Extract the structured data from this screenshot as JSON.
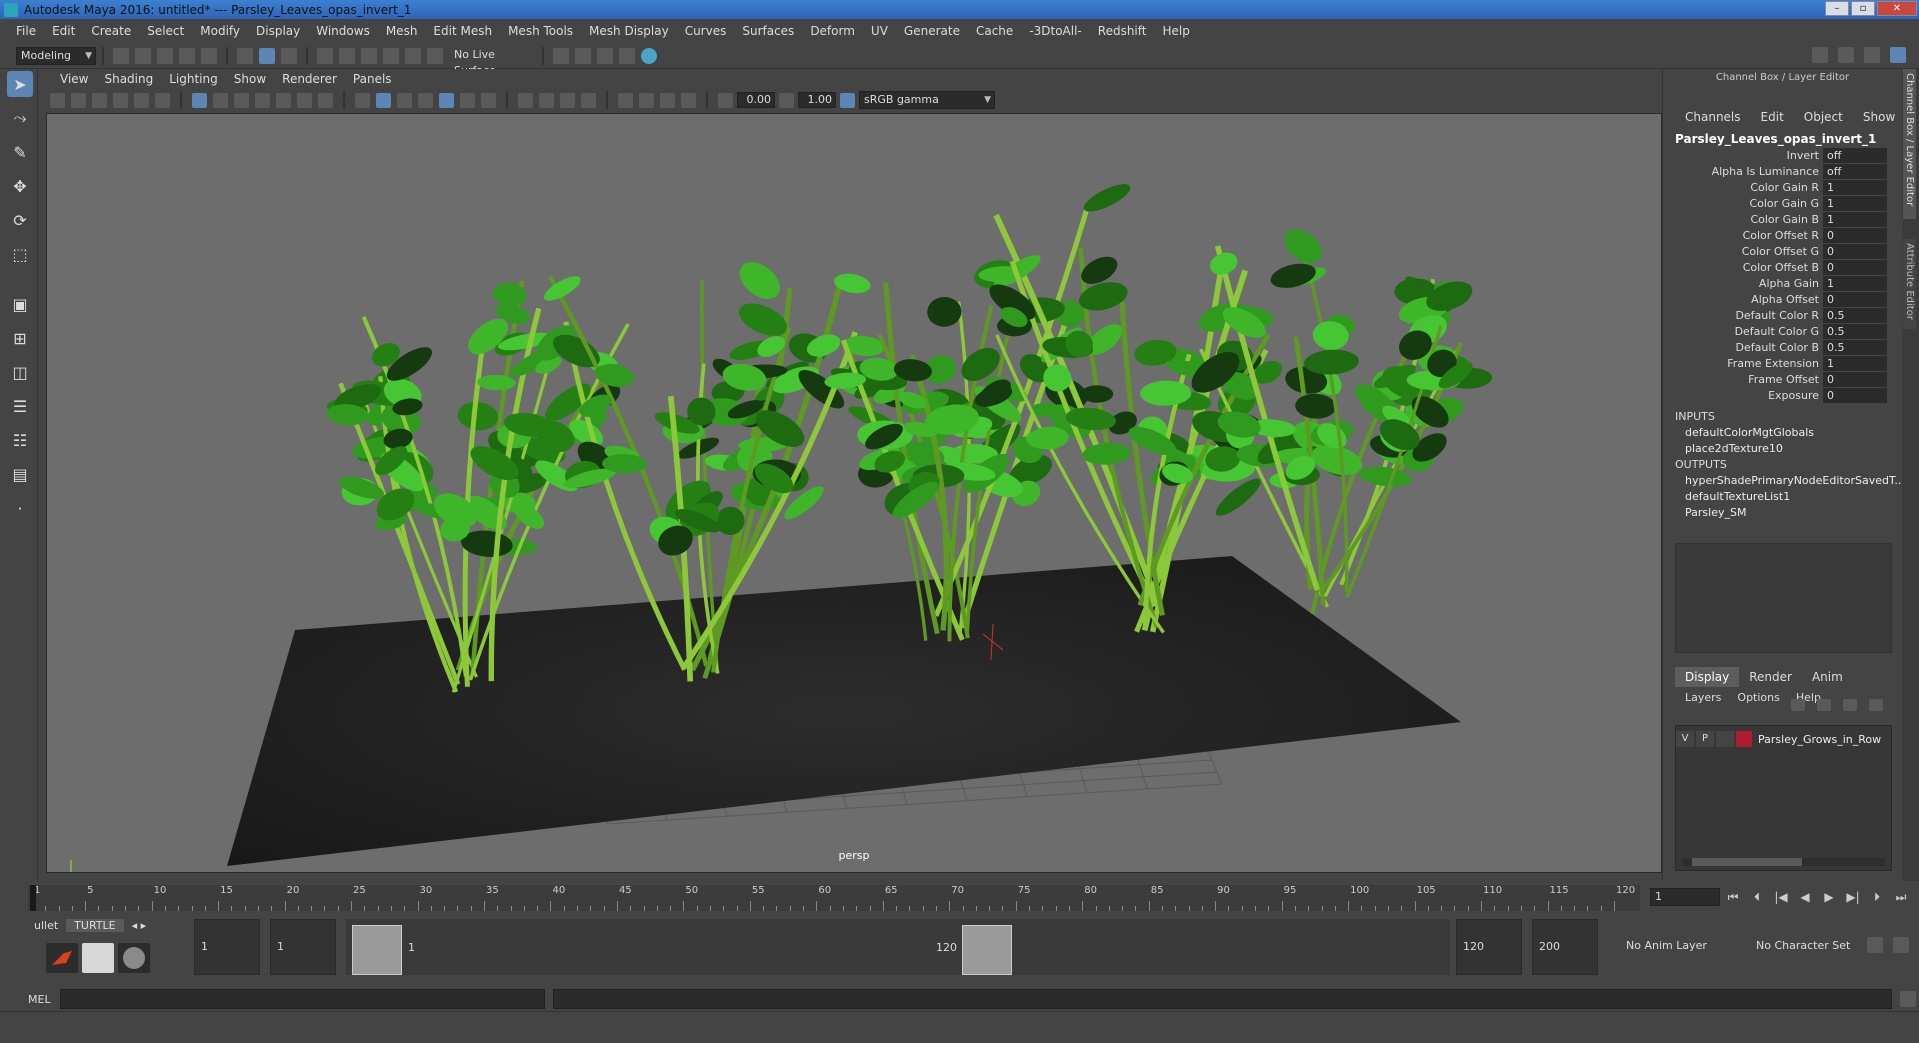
{
  "window": {
    "title": "Autodesk Maya 2016: untitled*   ---   Parsley_Leaves_opas_invert_1"
  },
  "menubar": [
    "File",
    "Edit",
    "Create",
    "Select",
    "Modify",
    "Display",
    "Windows",
    "Mesh",
    "Edit Mesh",
    "Mesh Tools",
    "Mesh Display",
    "Curves",
    "Surfaces",
    "Deform",
    "UV",
    "Generate",
    "Cache",
    "-3DtoAll-",
    "Redshift",
    "Help"
  ],
  "statusline": {
    "menu_set": "Modeling",
    "live_surface": "No Live Surface"
  },
  "panel": {
    "menus": [
      "View",
      "Shading",
      "Lighting",
      "Show",
      "Renderer",
      "Panels"
    ],
    "exposure": "0.00",
    "gamma": "1.00",
    "color_space": "sRGB gamma",
    "camera_label": "persp"
  },
  "channel_box": {
    "header": "Channel Box / Layer Editor",
    "tabs": [
      "Channels",
      "Edit",
      "Object",
      "Show"
    ],
    "node": "Parsley_Leaves_opas_invert_1",
    "attributes": [
      {
        "name": "Invert",
        "value": "off"
      },
      {
        "name": "Alpha Is Luminance",
        "value": "off"
      },
      {
        "name": "Color Gain R",
        "value": "1"
      },
      {
        "name": "Color Gain G",
        "value": "1"
      },
      {
        "name": "Color Gain B",
        "value": "1"
      },
      {
        "name": "Color Offset R",
        "value": "0"
      },
      {
        "name": "Color Offset G",
        "value": "0"
      },
      {
        "name": "Color Offset B",
        "value": "0"
      },
      {
        "name": "Alpha Gain",
        "value": "1"
      },
      {
        "name": "Alpha Offset",
        "value": "0"
      },
      {
        "name": "Default Color R",
        "value": "0.5"
      },
      {
        "name": "Default Color G",
        "value": "0.5"
      },
      {
        "name": "Default Color B",
        "value": "0.5"
      },
      {
        "name": "Frame Extension",
        "value": "1"
      },
      {
        "name": "Frame Offset",
        "value": "0"
      },
      {
        "name": "Exposure",
        "value": "0"
      }
    ],
    "inputs_title": "INPUTS",
    "inputs": [
      "defaultColorMgtGlobals",
      "place2dTexture10"
    ],
    "outputs_title": "OUTPUTS",
    "outputs": [
      "hyperShadePrimaryNodeEditorSavedT...",
      "defaultTextureList1",
      "Parsley_SM"
    ]
  },
  "layer_editor": {
    "tabs": [
      "Display",
      "Render",
      "Anim"
    ],
    "menus": [
      "Layers",
      "Options",
      "Help"
    ],
    "layer": {
      "v": "V",
      "p": "P",
      "name": "Parsley_Grows_in_Row",
      "color": "#b01c2e"
    }
  },
  "side_tabs": [
    "Channel Box / Layer Editor",
    "Attribute Editor"
  ],
  "time_slider": {
    "ticks": [
      "1",
      "5",
      "10",
      "15",
      "20",
      "25",
      "30",
      "35",
      "40",
      "45",
      "50",
      "55",
      "60",
      "65",
      "70",
      "75",
      "80",
      "85",
      "90",
      "95",
      "100",
      "105",
      "110",
      "115",
      "120"
    ],
    "current_frame": "1"
  },
  "range": {
    "start": "1",
    "playback_start": "1",
    "range_start_label": "1",
    "range_end_label": "120",
    "playback_end": "120",
    "end": "200",
    "anim_layer": "No Anim Layer",
    "character_set": "No Character Set"
  },
  "shelf": {
    "tabs": [
      "ullet",
      "TURTLE"
    ]
  },
  "cmdline": {
    "label": "MEL"
  }
}
